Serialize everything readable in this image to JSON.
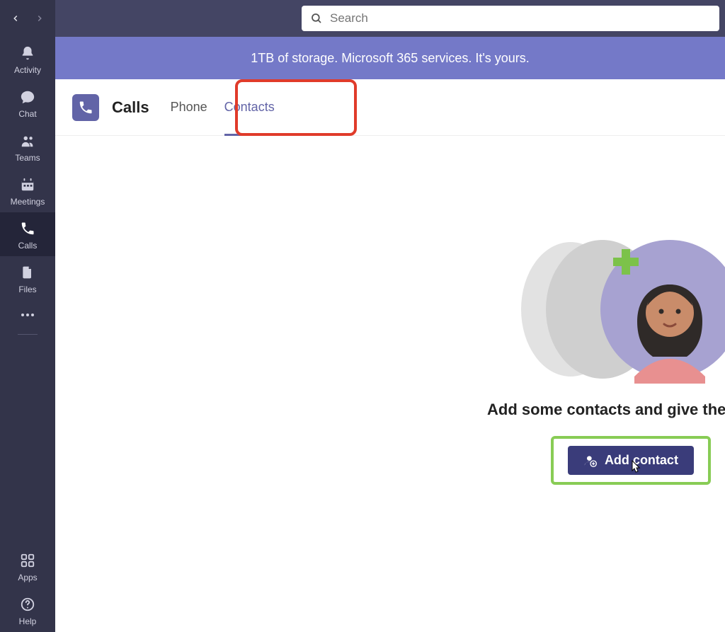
{
  "search": {
    "placeholder": "Search"
  },
  "banner": {
    "text": "1TB of storage. Microsoft 365 services. It's yours."
  },
  "rail": {
    "items": [
      {
        "id": "activity",
        "label": "Activity"
      },
      {
        "id": "chat",
        "label": "Chat"
      },
      {
        "id": "teams",
        "label": "Teams"
      },
      {
        "id": "meetings",
        "label": "Meetings"
      },
      {
        "id": "calls",
        "label": "Calls"
      },
      {
        "id": "files",
        "label": "Files"
      }
    ],
    "bottom": [
      {
        "id": "apps",
        "label": "Apps"
      },
      {
        "id": "help",
        "label": "Help"
      }
    ]
  },
  "header": {
    "title": "Calls",
    "tabs": [
      {
        "id": "phone",
        "label": "Phone",
        "active": false
      },
      {
        "id": "contacts",
        "label": "Contacts",
        "active": true
      }
    ]
  },
  "empty": {
    "title": "Add some contacts and give them a ca",
    "button": "Add contact"
  },
  "colors": {
    "accent": "#6264a7",
    "rail": "#33344a",
    "titlebar": "#444564",
    "banner": "#7479c8",
    "highlight_red": "#e03b2a",
    "highlight_green": "#88cc55"
  }
}
